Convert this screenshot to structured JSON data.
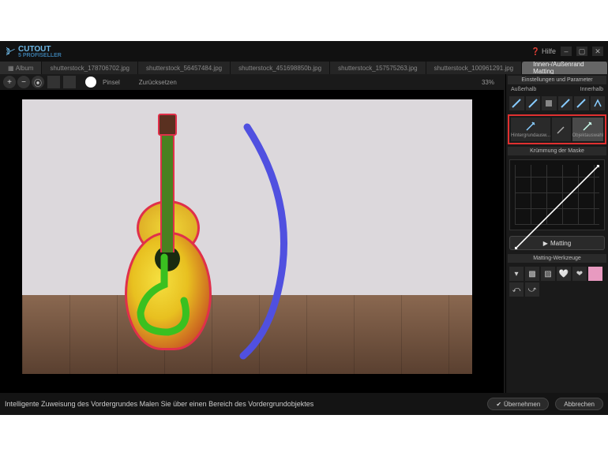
{
  "app": {
    "brand_top": "CUTOUT",
    "brand_sub": "5 PROFISELLER",
    "help_label": "Hilfe"
  },
  "tabs": {
    "album": "Album",
    "items": [
      "shutterstock_178706702.jpg",
      "shutterstock_56457484.jpg",
      "shutterstock_451698850b.jpg",
      "shutterstock_157575263.jpg",
      "shutterstock_100961291.jpg"
    ],
    "active": "Innen-/Außenrand Matting"
  },
  "toolbar": {
    "brush_label": "Pinsel",
    "undo_label": "Zurücksetzen",
    "zoom_pct": "33%"
  },
  "panel": {
    "header": "Einstellungen und Parameter",
    "outside": "Außerhalb",
    "inside": "Innerhalb",
    "bg_select": "Hintergrundausw...",
    "obj_select": "Objektauswahl",
    "curve_header": "Krümmung der Maske",
    "matting_btn": "Matting",
    "tools_header": "Matting-Werkzeuge"
  },
  "status": {
    "hint": "Intelligente Zuweisung des Vordergrundes  Malen Sie über einen Bereich des Vordergrundobjektes",
    "apply": "Übernehmen",
    "cancel": "Abbrechen"
  },
  "colors": {
    "highlight": "#e03030",
    "stroke_green": "#3ac020",
    "stroke_blue": "#5050e0"
  }
}
